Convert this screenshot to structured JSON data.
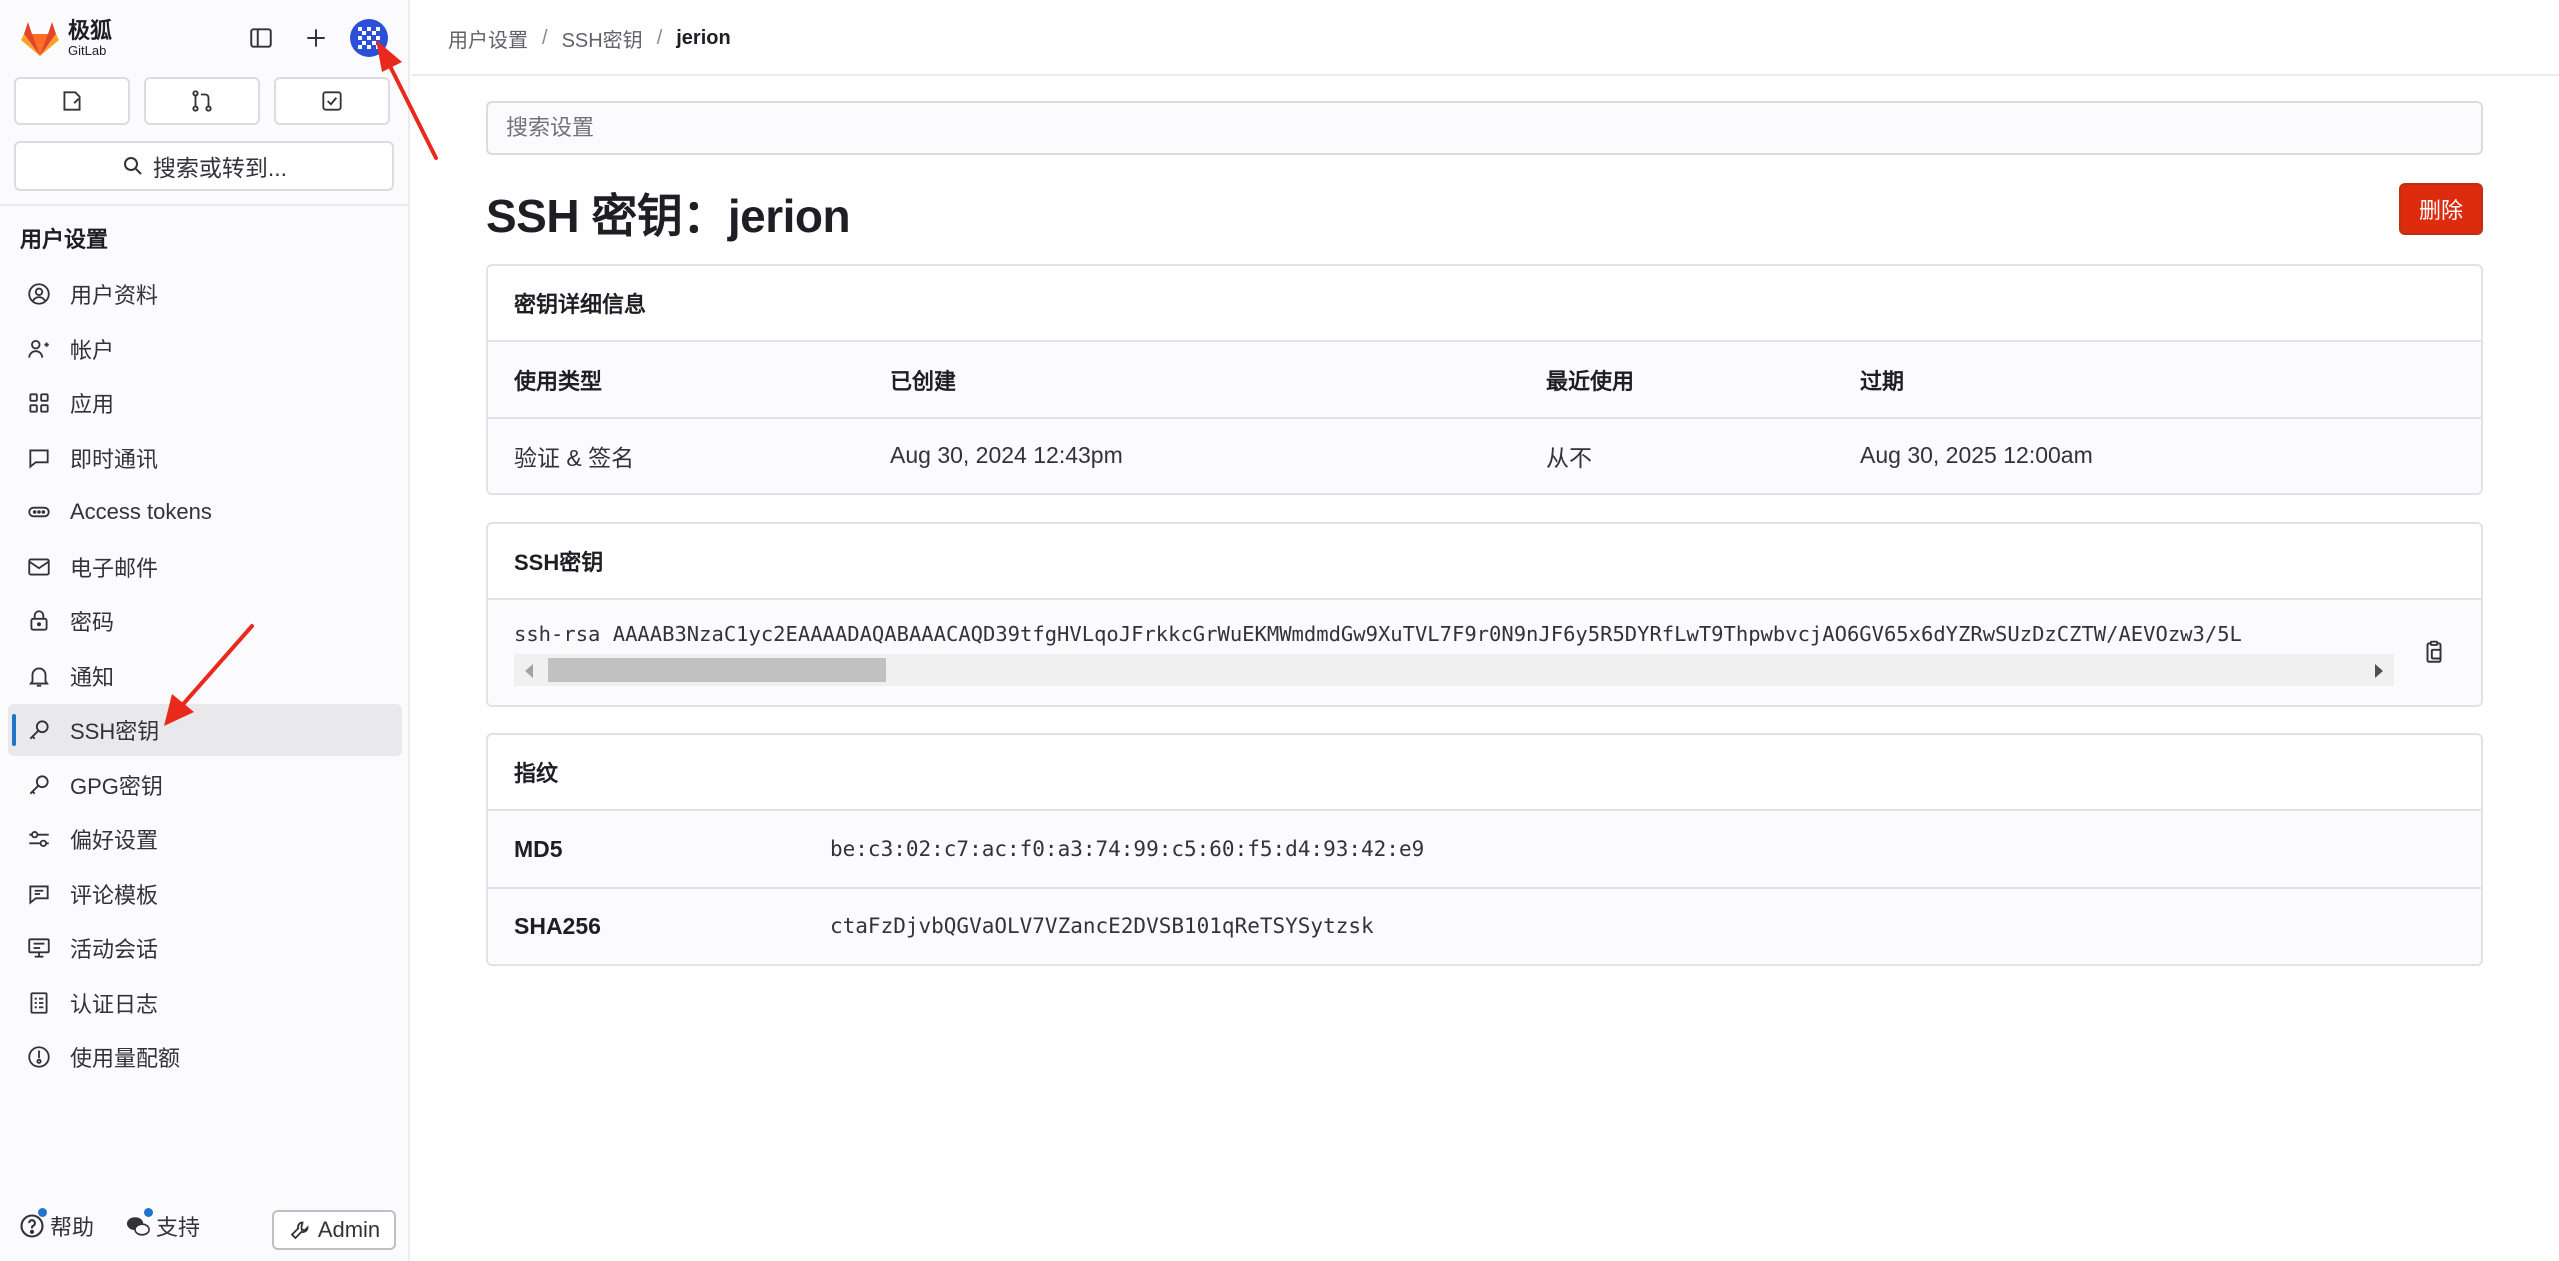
{
  "app": {
    "logo_text": "极狐",
    "logo_subtext": "GitLab"
  },
  "sidebar": {
    "search_label": "搜索或转到...",
    "section_title": "用户设置",
    "items": [
      {
        "label": "用户资料",
        "icon": "profile-icon"
      },
      {
        "label": "帐户",
        "icon": "account-icon"
      },
      {
        "label": "应用",
        "icon": "applications-icon"
      },
      {
        "label": "即时通讯",
        "icon": "chat-icon"
      },
      {
        "label": "Access tokens",
        "icon": "token-icon"
      },
      {
        "label": "电子邮件",
        "icon": "mail-icon"
      },
      {
        "label": "密码",
        "icon": "lock-icon"
      },
      {
        "label": "通知",
        "icon": "bell-icon"
      },
      {
        "label": "SSH密钥",
        "icon": "key-icon",
        "active": true
      },
      {
        "label": "GPG密钥",
        "icon": "key-icon"
      },
      {
        "label": "偏好设置",
        "icon": "preferences-icon"
      },
      {
        "label": "评论模板",
        "icon": "comment-template-icon"
      },
      {
        "label": "活动会话",
        "icon": "monitor-icon"
      },
      {
        "label": "认证日志",
        "icon": "log-icon"
      },
      {
        "label": "使用量配额",
        "icon": "quota-icon"
      }
    ],
    "footer": {
      "help_label": "帮助",
      "support_label": "支持",
      "admin_label": "Admin"
    }
  },
  "breadcrumb": {
    "items": [
      "用户设置",
      "SSH密钥",
      "jerion"
    ]
  },
  "main": {
    "search_placeholder": "搜索设置",
    "title": "SSH 密钥：jerion",
    "delete_label": "删除",
    "details": {
      "header": "密钥详细信息",
      "columns": [
        "使用类型",
        "已创建",
        "最近使用",
        "过期"
      ],
      "values": [
        "验证 & 签名",
        "Aug 30, 2024 12:43pm",
        "从不",
        "Aug 30, 2025 12:00am"
      ]
    },
    "ssh_key": {
      "header": "SSH密钥",
      "value": "ssh-rsa AAAAB3NzaC1yc2EAAAADAQABAAACAQD39tfgHVLqoJFrkkcGrWuEKMWmdmdGw9XuTVL7F9r0N9nJF6y5R5DYRfLwT9ThpwbvcjAO6GV65x6dYZRwSUzDzCZTW/AEVOzw3/5L"
    },
    "fingerprints": {
      "header": "指纹",
      "rows": [
        {
          "label": "MD5",
          "value": "be:c3:02:c7:ac:f0:a3:74:99:c5:60:f5:d4:93:42:e9"
        },
        {
          "label": "SHA256",
          "value": "ctaFzDjvbQGVaOLV7VZancE2DVSB101qReTSYSytzsk"
        }
      ]
    }
  },
  "colors": {
    "accent": "#1f75cb",
    "danger": "#dd2b0e",
    "annotation_arrow": "#e8291c"
  }
}
